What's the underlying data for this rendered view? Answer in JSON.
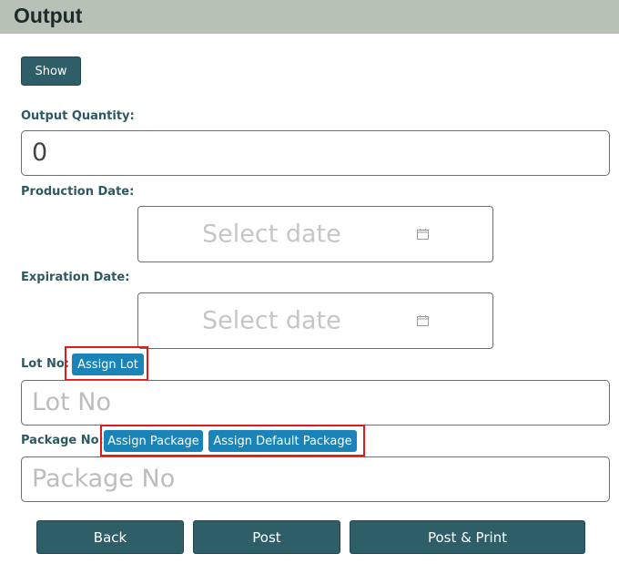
{
  "header": {
    "title": "Output"
  },
  "show_button": {
    "label": "Show"
  },
  "output_quantity": {
    "label": "Output Quantity:",
    "value": "0"
  },
  "production_date": {
    "label": "Production Date:",
    "placeholder": "Select date"
  },
  "expiration_date": {
    "label": "Expiration Date:",
    "placeholder": "Select date"
  },
  "lot": {
    "label": "Lot No:",
    "assign_label": "Assign Lot",
    "placeholder": "Lot No"
  },
  "package": {
    "label": "Package No:",
    "assign_label": "Assign Package",
    "assign_default_label": "Assign Default Package",
    "placeholder": "Package No"
  },
  "footer": {
    "back_label": "Back",
    "post_label": "Post",
    "post_print_label": "Post & Print"
  },
  "icons": {
    "calendar": "calendar-icon"
  },
  "colors": {
    "header_bg": "#b7c1b6",
    "primary": "#2e5e68",
    "accent_blue": "#1a84b8",
    "label": "#2d5960",
    "highlight": "#e01a1a"
  }
}
